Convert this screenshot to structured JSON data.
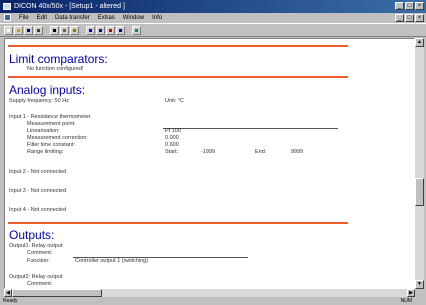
{
  "window": {
    "title": "DICON 40x/50x - [Setup1 - altered ]"
  },
  "menu": [
    "File",
    "Edit",
    "Data transfer",
    "Extras",
    "Window",
    "Info"
  ],
  "toolbar_icons": [
    "new-icon",
    "open-icon",
    "save-icon",
    "print-icon",
    "cut-icon",
    "copy-icon",
    "paste-icon",
    "transfer-icon",
    "settings-icon",
    "info-icon",
    "chart-icon",
    "help-icon"
  ],
  "accent": "#f25c28",
  "heading_color": "#0000aa",
  "limit": {
    "heading": "Limit comparators:",
    "none": "No function configured!"
  },
  "analog": {
    "heading": "Analog inputs:",
    "supply": "Supply frequency: 50 Hz",
    "unit": "Unit: °C",
    "input1": {
      "title": "Input 1 - Resistance thermometer",
      "rows": [
        {
          "label": "Measurement point:",
          "value": ""
        },
        {
          "label": "Linearisation:",
          "value": "Pt 100"
        },
        {
          "label": "Measurement correction:",
          "value": "0.000"
        },
        {
          "label": "Filter time constant:",
          "value": "0.600"
        }
      ],
      "range_label": "Range limiting:",
      "start_label": "Start:",
      "start_value": "-1999",
      "end_label": "End:",
      "end_value": "9999"
    },
    "input2": "Input 2 - Not connected",
    "input3": "Input 3 - Not connected",
    "input4": "Input 4 - Not connected"
  },
  "outputs": {
    "heading": "Outputs:",
    "output1": {
      "title": "Output1: Relay output",
      "comment_label": "Comment:",
      "comment_value": "",
      "function_label": "Function:",
      "function_value": "Controller output 1 (switching)"
    },
    "output2": {
      "title": "Output2: Relay output",
      "comment_label": "Comment:"
    }
  },
  "status": {
    "left": "Ready",
    "right": "NUM"
  }
}
